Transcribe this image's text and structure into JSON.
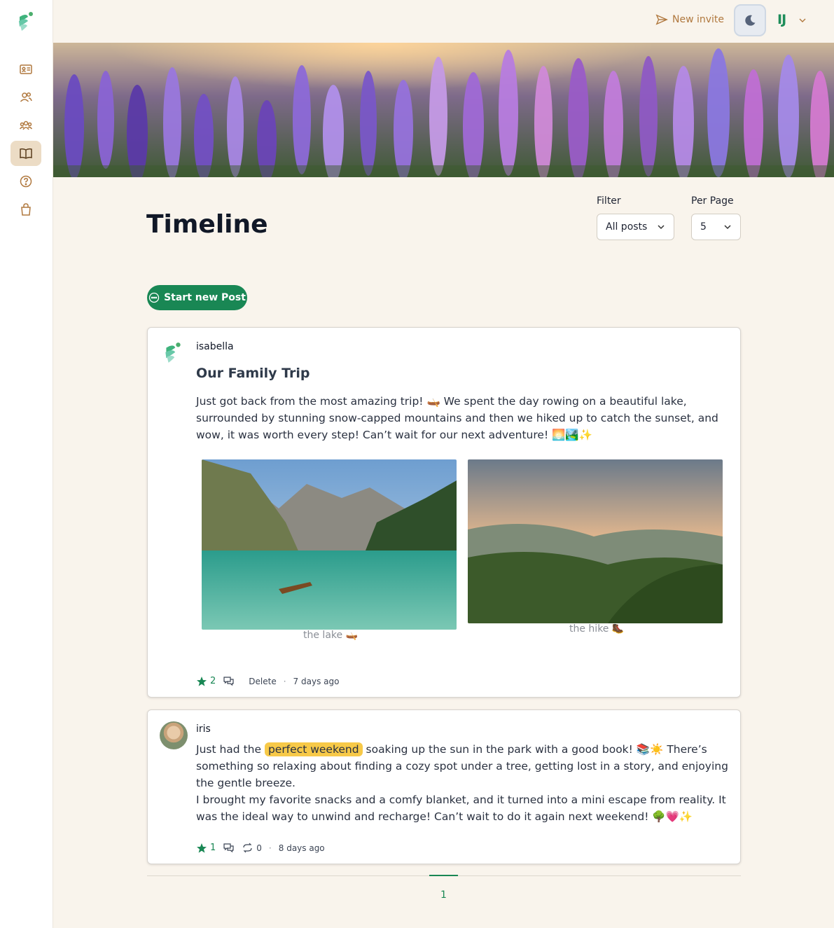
{
  "topbar": {
    "invite_label": "New invite",
    "user_initials": "IJ"
  },
  "sidebar": {
    "items": [
      {
        "icon": "id-card-icon"
      },
      {
        "icon": "users-icon"
      },
      {
        "icon": "group-icon"
      },
      {
        "icon": "book-icon",
        "active": true
      },
      {
        "icon": "help-icon"
      },
      {
        "icon": "shopping-bag-icon"
      }
    ]
  },
  "header": {
    "title": "Timeline",
    "filter_label": "Filter",
    "filter_value": "All posts",
    "perpage_label": "Per Page",
    "perpage_value": "5",
    "new_post_label": "Start new Post"
  },
  "posts": [
    {
      "author": "isabella",
      "title": "Our Family Trip",
      "body": "Just got back from the most amazing trip! 🛶 We spent the day rowing on a beautiful lake, surrounded by stunning snow-capped mountains and then we hiked up to catch the sunset, and wow, it was worth every step! Can’t wait for our next adventure! 🌅🏞️✨",
      "images": [
        {
          "caption": "the lake 🛶"
        },
        {
          "caption": "the hike 🥾"
        }
      ],
      "stars": "2",
      "delete_label": "Delete",
      "time": "7 days ago"
    },
    {
      "author": "iris",
      "body_before": "Just had the ",
      "highlight": "perfect weekend",
      "body_after": " soaking up the sun in the park with a good book! 📚☀️ There’s something so relaxing about finding a cozy spot under a tree, getting lost in a story, and enjoying the gentle breeze.",
      "body2": "I brought my favorite snacks and a comfy blanket, and it turned into a mini escape from reality. It was the ideal way to unwind and recharge! Can’t wait to do it again next weekend! 🌳💗✨",
      "stars": "1",
      "reposts": "0",
      "time": "8 days ago"
    }
  ],
  "pagination": {
    "current": "1"
  },
  "colors": {
    "accent": "#198754",
    "brand_brown": "#b0783e",
    "background": "#f9f4ec"
  }
}
